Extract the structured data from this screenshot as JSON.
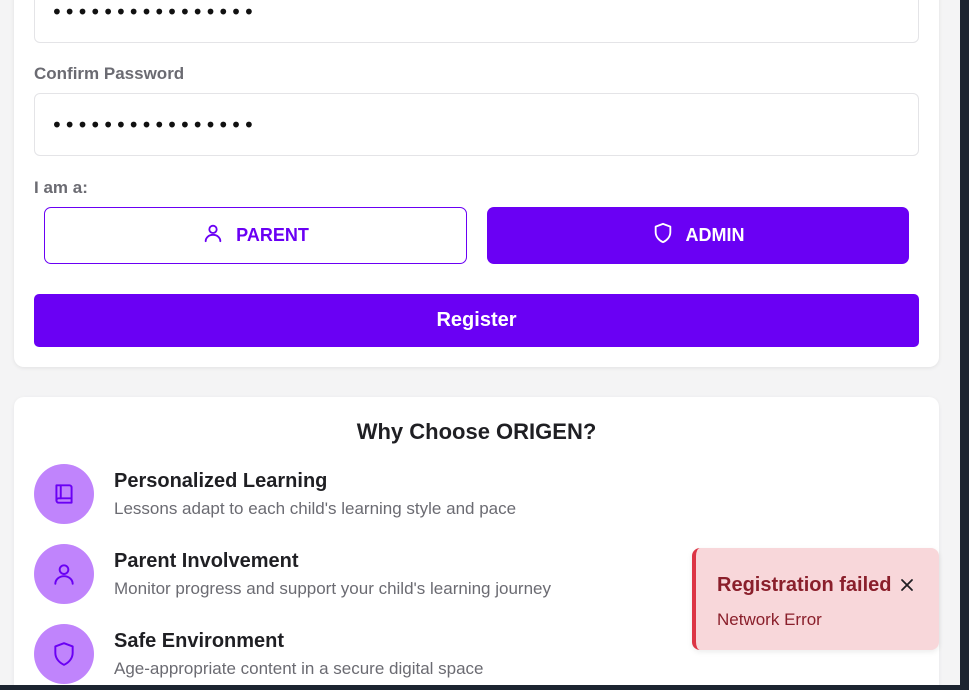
{
  "registration": {
    "password_value": "••••••••••••••••",
    "confirm_label": "Confirm Password",
    "confirm_value": "••••••••••••••••",
    "role_label": "I am a:",
    "roles": [
      {
        "label": "PARENT",
        "icon": "user-icon",
        "selected": false
      },
      {
        "label": "ADMIN",
        "icon": "shield-icon",
        "selected": true
      }
    ],
    "register_label": "Register"
  },
  "why": {
    "title": "Why Choose ORIGEN?",
    "features": [
      {
        "title": "Personalized Learning",
        "description": "Lessons adapt to each child's learning style and pace",
        "icon": "book-icon"
      },
      {
        "title": "Parent Involvement",
        "description": "Monitor progress and support your child's learning journey",
        "icon": "user-icon"
      },
      {
        "title": "Safe Environment",
        "description": "Age-appropriate content in a secure digital space",
        "icon": "shield-icon"
      }
    ]
  },
  "toast": {
    "title": "Registration failed",
    "message": "Network Error"
  },
  "colors": {
    "accent": "#6a00f4",
    "feature_icon_bg": "#c084fc",
    "toast_bg": "#f8d7da",
    "toast_border": "#dc3545",
    "toast_text": "#8a1f2b"
  }
}
